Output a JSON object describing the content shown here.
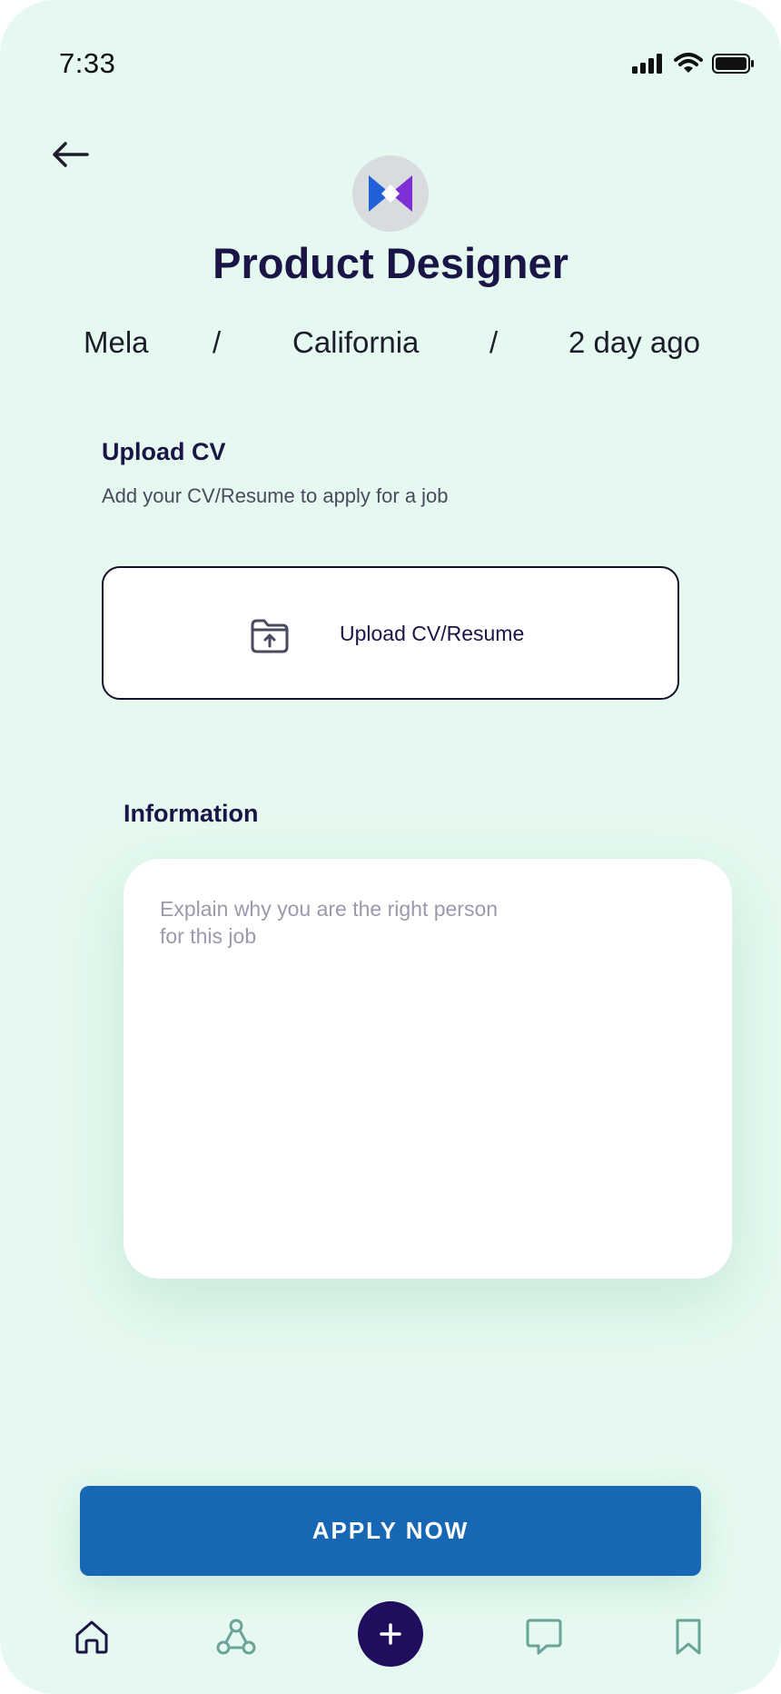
{
  "status_bar": {
    "time": "7:33",
    "icons": [
      "cellular-signal-icon",
      "wifi-icon",
      "battery-icon"
    ]
  },
  "header": {
    "back_icon": "arrow-left-icon",
    "job_title": "Product Designer",
    "company": "Mela",
    "separator": "/",
    "location": "California",
    "posted": "2 day ago"
  },
  "upload": {
    "heading": "Upload CV",
    "subtitle": "Add your CV/Resume to apply for a job",
    "button_label": "Upload CV/Resume",
    "icon": "folder-upload-icon"
  },
  "information": {
    "heading": "Information",
    "placeholder": "Explain why you are the right person\nfor this job",
    "value": ""
  },
  "apply_label": "APPLY NOW",
  "bottom_nav": {
    "items": [
      {
        "icon": "home-icon",
        "active": true
      },
      {
        "icon": "network-icon",
        "active": false
      },
      {
        "icon": "plus-icon",
        "active": false
      },
      {
        "icon": "chat-icon",
        "active": false
      },
      {
        "icon": "bookmark-icon",
        "active": false
      }
    ]
  },
  "colors": {
    "background": "#e6f9f0",
    "primary_text": "#1a1447",
    "apply_button": "#1867b4",
    "nav_add": "#200d5e",
    "nav_inactive": "#6aa398"
  }
}
